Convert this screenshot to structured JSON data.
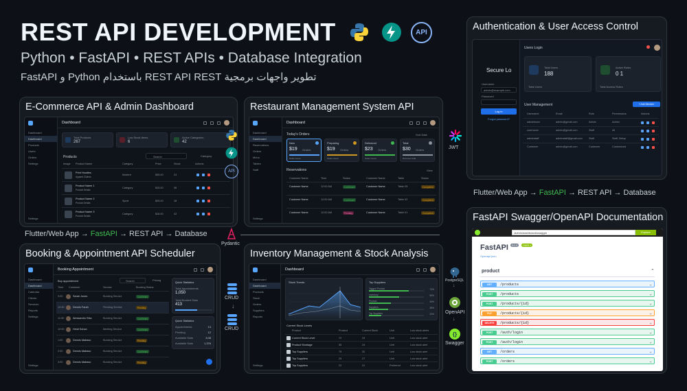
{
  "header": {
    "title": "REST API DEVELOPMENT",
    "subtitle": "Python • FastAPI • REST APIs • Database Integration",
    "arabic": "تطوير واجهات برمجية REST API REST باستخدام Python و FastAPI",
    "api_badge": "API"
  },
  "flow_top": {
    "a": "Flutter/Web App",
    "arrow1": "→",
    "b": "FastAPI",
    "arrow2": "→",
    "c": "REST API",
    "arrow3": "→",
    "d": "Database"
  },
  "flow_auth": {
    "a": "Flutter/Web App",
    "arrow1": "→",
    "b": "FastAPI",
    "arrow2": "→",
    "c": "REST API",
    "arrow3": "→",
    "d": "Database"
  },
  "side_labels": {
    "pydantic": "Pydantic",
    "crud1": "CRUD",
    "crud2": "CRUD",
    "jwt": "JWT",
    "postgres": "PostgreSQL",
    "openapi": "OpenAPI",
    "swagger": "Swagger",
    "api_small": "API"
  },
  "ecom": {
    "title": "E-Commerce API & Admin Dashboard",
    "screen_title": "Dashboard",
    "nav": [
      "Dashboard",
      "Dashboard",
      "Products",
      "Users",
      "Orders",
      "Settings"
    ],
    "nav_bottom": "Settings",
    "stats": [
      {
        "label": "Total Products",
        "value": "267"
      },
      {
        "label": "Low Stock Items",
        "value": "6"
      },
      {
        "label": "Active Categories",
        "value": "42"
      }
    ],
    "products_title": "Products",
    "search": "Search",
    "category_btn": "Category",
    "columns": [
      "Image",
      "Product Name",
      "Category",
      "Price",
      "Stock",
      "Actions"
    ],
    "rows": [
      {
        "name": "Print Hoodies",
        "sub": "Apparel Clothes",
        "cat": "Modern",
        "price": "$35.00",
        "stock": "24"
      },
      {
        "name": "Product Name 1",
        "sub": "Product Details",
        "cat": "Category",
        "price": "$15.00",
        "stock": "36"
      },
      {
        "name": "Product Name 2",
        "sub": "Product Details",
        "cat": "Sport",
        "price": "$25.00",
        "stock": "18"
      },
      {
        "name": "Product Name 3",
        "sub": "Product Details",
        "cat": "Category",
        "price": "$16.00",
        "stock": "42"
      }
    ]
  },
  "restaurant": {
    "title": "Restaurant Management System API",
    "screen_title": "Dashboard",
    "nav": [
      "Dashboard",
      "Dashboard",
      "Reservations",
      "Orders",
      "Menu",
      "Tables",
      "Staff",
      "Settings"
    ],
    "nav_bottom": "Settings",
    "orders_title": "Today's Orders",
    "orders_filter": "Sort Date",
    "orders": [
      {
        "label": "New",
        "value": "$19",
        "unit": "Orders",
        "sub": "Order Count"
      },
      {
        "label": "Preparing",
        "value": "$19",
        "unit": "Orders",
        "sub": "Order Count"
      },
      {
        "label": "Delivered",
        "value": "$23",
        "unit": "Orders",
        "sub": "Order Count"
      },
      {
        "label": "Total",
        "value": "$30",
        "unit": "Orders",
        "sub": "Revenue Total"
      }
    ],
    "res_title": "Reservations",
    "res_filter": "View",
    "res_cols": [
      "Customer Name",
      "Time",
      "Status",
      "Customer Name",
      "Table",
      "Status"
    ],
    "res_rows": [
      {
        "name": "Customer Name",
        "time": "12:00 AM",
        "status": "Confirmed",
        "name2": "Customer Name",
        "table": "Table 05",
        "status2": "Completed"
      },
      {
        "name": "Customer Name",
        "time": "12:00 AM",
        "status": "Confirmed",
        "name2": "Customer Name",
        "table": "Table 02",
        "status2": "Completed"
      },
      {
        "name": "Customer Name",
        "time": "12:00 AM",
        "status": "Pending",
        "name2": "Customer Name",
        "table": "Table 01",
        "status2": "Completed"
      }
    ]
  },
  "auth": {
    "title": "Authentication & User Access Control",
    "login_title": "Secure Lo",
    "username_label": "Username",
    "username_value": "admin@example.com",
    "password_label": "Password",
    "login_btn": "Log in",
    "forgot": "Forgot password?",
    "users_login": "Users Login",
    "total_users_label": "Total Users",
    "total_users_value": "188",
    "active_roles_label": "Active Roles",
    "active_roles_value": "0 1",
    "total_users_link": "Total Users",
    "total_roles_link": "Total Access Roles",
    "um_title": "User Management",
    "add_btn": "+ Add Member",
    "cols": [
      "Username",
      "Email",
      "Role",
      "Permissions",
      "Actions"
    ],
    "rows": [
      {
        "u": "adminteam",
        "e": "admin@gmail.com",
        "r": "Admin",
        "p": "Admin"
      },
      {
        "u": "username",
        "e": "admin@gmail.com",
        "r": "Staff",
        "p": "All"
      },
      {
        "u": "adminstaff",
        "e": "adminstaff@gmail.com",
        "r": "Staff",
        "p": "Staff, Setup"
      },
      {
        "u": "Customer",
        "e": "admin@gmail.com",
        "r": "Customer",
        "p": "Customized"
      }
    ]
  },
  "booking": {
    "title": "Booking & Appointment API Scheduler",
    "screen_title": "Booking Appointment",
    "nav": [
      "Dashboard",
      "Dashboard",
      "Calendar",
      "Clients",
      "Services",
      "Reports",
      "Settings"
    ],
    "nav_bottom": "Settings",
    "list_title": "Buy appointment",
    "search": "Search",
    "filter": "Pricing",
    "cols": [
      "Time",
      "Customer",
      "Service",
      "Booking Status"
    ],
    "rows": [
      {
        "t": "9:00",
        "c": "Sarah Jones",
        "s": "Booking Service",
        "st": "Confirmed",
        "k": "green"
      },
      {
        "t": "10:30",
        "c": "Dennis Farah",
        "s": "Pending Service",
        "st": "Pending",
        "k": "orange"
      },
      {
        "t": "11:00",
        "c": "Alessandro Sfax",
        "s": "Booking Service",
        "st": "Confirmed",
        "k": "green"
      },
      {
        "t": "12:00",
        "c": "Heidi Sohan",
        "s": "Meeting Service",
        "st": "Confirmed",
        "k": "green"
      },
      {
        "t": "1:00",
        "c": "Dennis Mabaso",
        "s": "Booking Service",
        "st": "Pending",
        "k": "orange"
      },
      {
        "t": "2:00",
        "c": "Dennis Mabaso",
        "s": "Booking Service",
        "st": "Confirmed",
        "k": "green"
      },
      {
        "t": "3:00",
        "c": "Dennis Mabaso",
        "s": "Booking Service",
        "st": "Pending",
        "k": "orange"
      }
    ],
    "qs_title": "Quick Statistics",
    "qs1_label": "Total Appointments",
    "qs1_value": "1,050",
    "qs2_label": "Total Booked Slots",
    "qs2_value": "413",
    "qs3_title": "Quick Statistics",
    "qs3_rows": [
      {
        "k": "Appointments",
        "v": "13"
      },
      {
        "k": "Pending",
        "v": "12"
      },
      {
        "k": "Available Slots",
        "v": "3,08"
      },
      {
        "k": "Available Slots",
        "v": "1,376"
      }
    ]
  },
  "inventory": {
    "title": "Inventory Management & Stock Analysis",
    "screen_title": "Dashboard",
    "nav": [
      "Dashboard",
      "Dashboard",
      "Products",
      "Stock",
      "Orders",
      "Suppliers",
      "Reports",
      "Settings"
    ],
    "nav_bottom": "Settings",
    "trends_title": "Stock Trends",
    "suppliers_title": "Top Suppliers",
    "suppliers": [
      {
        "name": "Tagged Product",
        "v": "72%",
        "pct": 0.72
      },
      {
        "name": "Inventory",
        "v": "55%",
        "pct": 0.55
      },
      {
        "name": "Product",
        "v": "40%",
        "pct": 0.4
      },
      {
        "name": "Suppliers",
        "v": "35%",
        "pct": 0.35
      },
      {
        "name": "Top Suppliers",
        "v": "22%",
        "pct": 0.22
      }
    ],
    "levels_title": "Current Stock Levels",
    "cols": [
      "Product",
      "Product",
      "Current Stock",
      "Unit",
      "Low stock alerts"
    ],
    "rows": [
      {
        "a": "Current Stock Level",
        "b": "72",
        "c": "24",
        "d": "Unit",
        "e": "Low stock alert"
      },
      {
        "a": "Product Shortage",
        "b": "35",
        "c": "24",
        "d": "Unit",
        "e": "Low stock alert"
      },
      {
        "a": "Top Suppliers",
        "b": "75",
        "c": "32",
        "d": "Unit",
        "e": "Low stock alert"
      },
      {
        "a": "Top Suppliers",
        "b": "25",
        "c": "27",
        "d": "Unit",
        "e": "Low stock alert"
      },
      {
        "a": "Top Suppliers",
        "b": "22",
        "c": "31",
        "d": "Preferred",
        "e": "Low stock alert"
      }
    ]
  },
  "swagger": {
    "title": "FastAPI Swagger/OpenAPI Documentation",
    "url": "/admin/dashboard/swagger",
    "explore": "Explore",
    "logo": "FastAPI",
    "version": "0.1.0",
    "oas": "OAS3.1",
    "subtitle": "Openapi.json",
    "section": "product",
    "endpoints": [
      {
        "m": "GET",
        "p": "/products",
        "c": "#61affe",
        "bg": "#ebf3fb"
      },
      {
        "m": "POST",
        "p": "/products",
        "c": "#49cc90",
        "bg": "#e8f6f0"
      },
      {
        "m": "POST",
        "p": "/products/{id}",
        "c": "#49cc90",
        "bg": "#e8f6f0"
      },
      {
        "m": "PUT",
        "p": "/products/{id}",
        "c": "#fca130",
        "bg": "#fbf1e6"
      },
      {
        "m": "DELETE",
        "p": "/products/{id}",
        "c": "#f93e3e",
        "bg": "#fbe7e7"
      },
      {
        "m": "POST",
        "p": "/auth/login",
        "c": "#49cc90",
        "bg": "#e8f6f0"
      },
      {
        "m": "POST",
        "p": "/auth/login",
        "c": "#49cc90",
        "bg": "#e8f6f0"
      },
      {
        "m": "GET",
        "p": "/orders",
        "c": "#61affe",
        "bg": "#ebf3fb"
      },
      {
        "m": "POST",
        "p": "/orders",
        "c": "#49cc90",
        "bg": "#e8f6f0"
      }
    ]
  },
  "colors": {
    "accent": "#58a6ff",
    "green": "#3fb950",
    "bg": "#0d1117",
    "panel": "#161b22"
  }
}
